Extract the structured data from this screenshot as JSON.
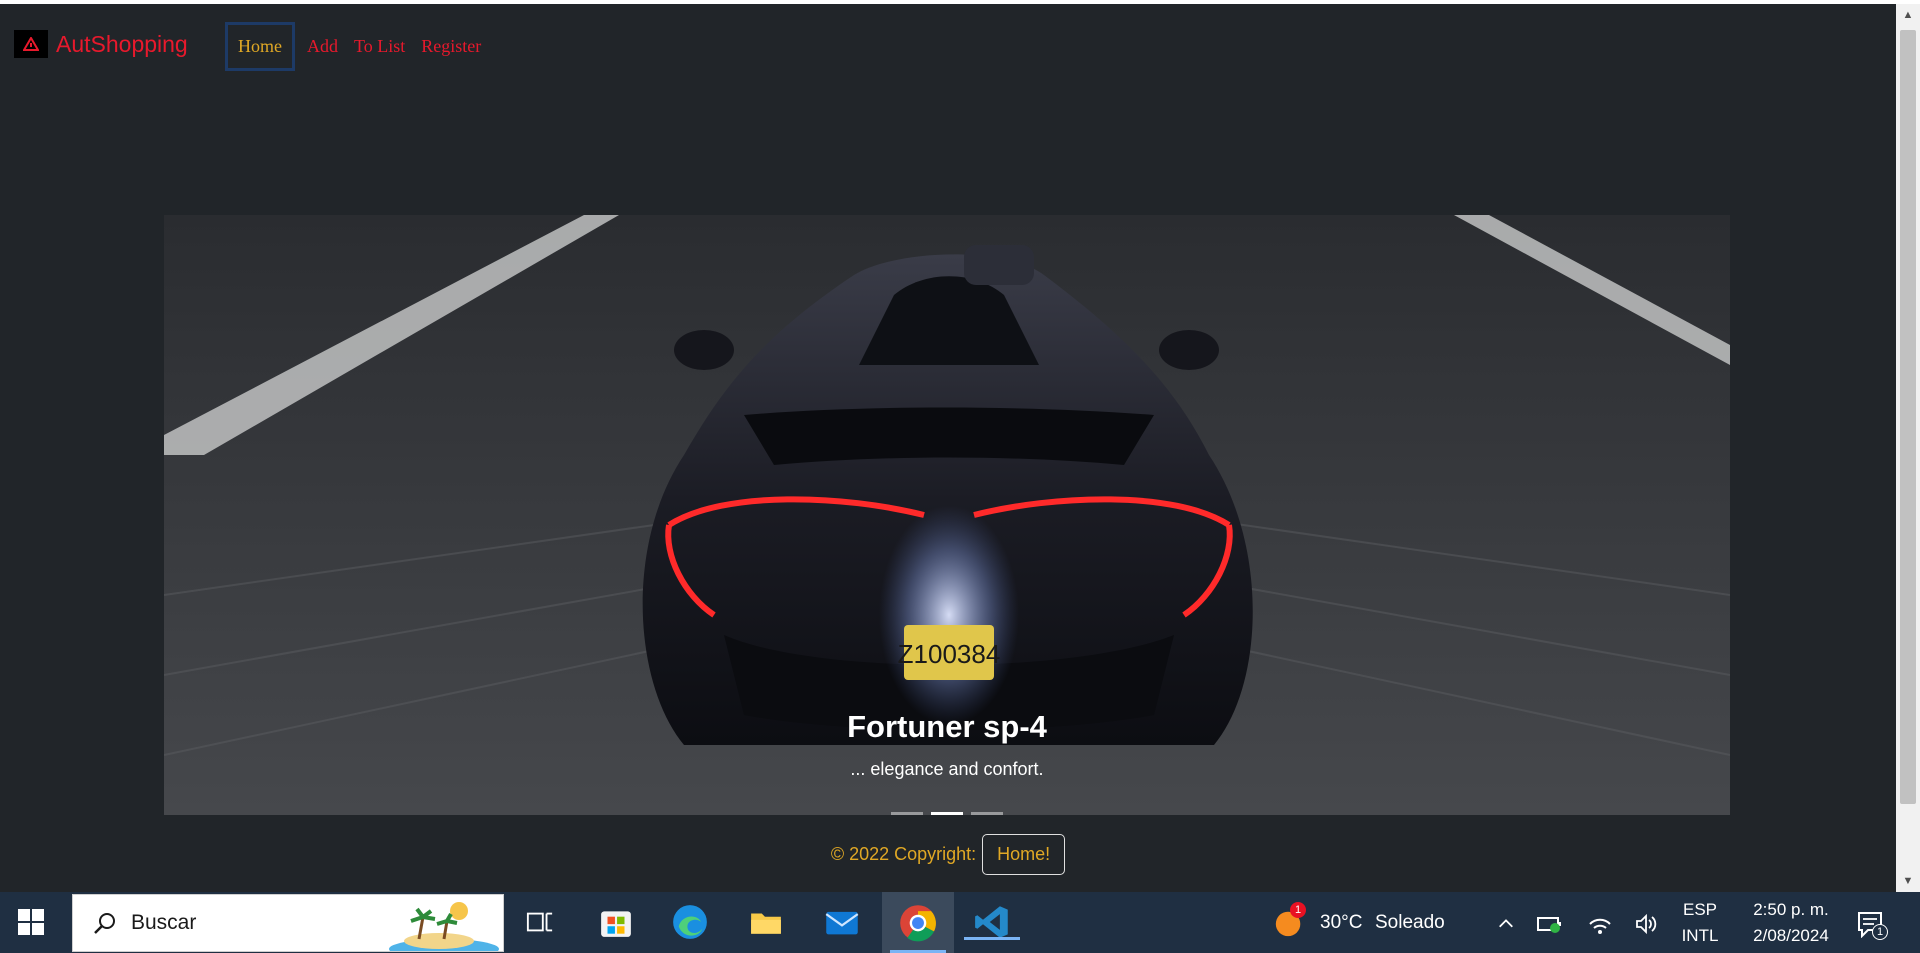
{
  "navbar": {
    "brand": "AutShopping",
    "links": [
      "Home",
      "Add",
      "To List",
      "Register"
    ]
  },
  "hero": {
    "caption_title": "Fortuner sp-4",
    "caption_text": "... elegance and confort.",
    "plate_text": "Z100384",
    "slides_count": 3,
    "active_slide": 1
  },
  "footer": {
    "copyright": "© 2022 Copyright:",
    "button": "Home!"
  },
  "taskbar": {
    "search_placeholder": "Buscar",
    "weather_badge": "1",
    "temperature": "30°C",
    "weather_text": "Soleado",
    "lang_top": "ESP",
    "lang_bottom": "INTL",
    "time": "2:50 p. m.",
    "date": "2/08/2024",
    "notification_count": "1"
  },
  "colors": {
    "page_bg": "#212529",
    "brand_red": "#e8192c",
    "accent_gold": "#e0a825",
    "taskbar_bg": "#1f2f42"
  }
}
